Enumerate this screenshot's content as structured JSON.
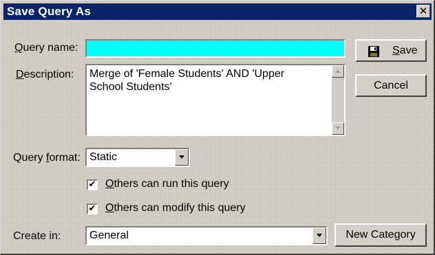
{
  "dialog": {
    "title": "Save Query As",
    "close_glyph": "✕"
  },
  "query_name": {
    "label_underlined": "Q",
    "label_rest": "uery name:",
    "value": "",
    "field_color": "#00ffff"
  },
  "description": {
    "label_underlined": "D",
    "label_rest": "escription:",
    "value": "Merge of 'Female Students' AND 'Upper\nSchool Students'"
  },
  "query_format": {
    "label_prefix": "Query ",
    "label_underlined": "f",
    "label_rest": "ormat:",
    "selected": "Static"
  },
  "options": {
    "others_run": {
      "underlined": "O",
      "rest": "thers can run this query",
      "checked": true
    },
    "others_modify": {
      "underlined": "O",
      "rest": "thers can modify this query",
      "checked": true
    },
    "check_glyph": "✔"
  },
  "create_in": {
    "label": "Create in:",
    "selected": "General"
  },
  "buttons": {
    "save_underlined": "S",
    "save_rest": "ave",
    "cancel": "Cancel",
    "new_category": "New Category"
  },
  "icons": {
    "save": "floppy-disk-icon",
    "close": "close-icon",
    "scroll_up": "scroll-up-arrow-icon",
    "scroll_down": "scroll-down-arrow-icon",
    "dropdown": "chevron-down-icon"
  },
  "colors": {
    "titlebar": "#0a246a",
    "dialog_bg": "#d4d0c8",
    "highlight_field": "#00ffff"
  }
}
